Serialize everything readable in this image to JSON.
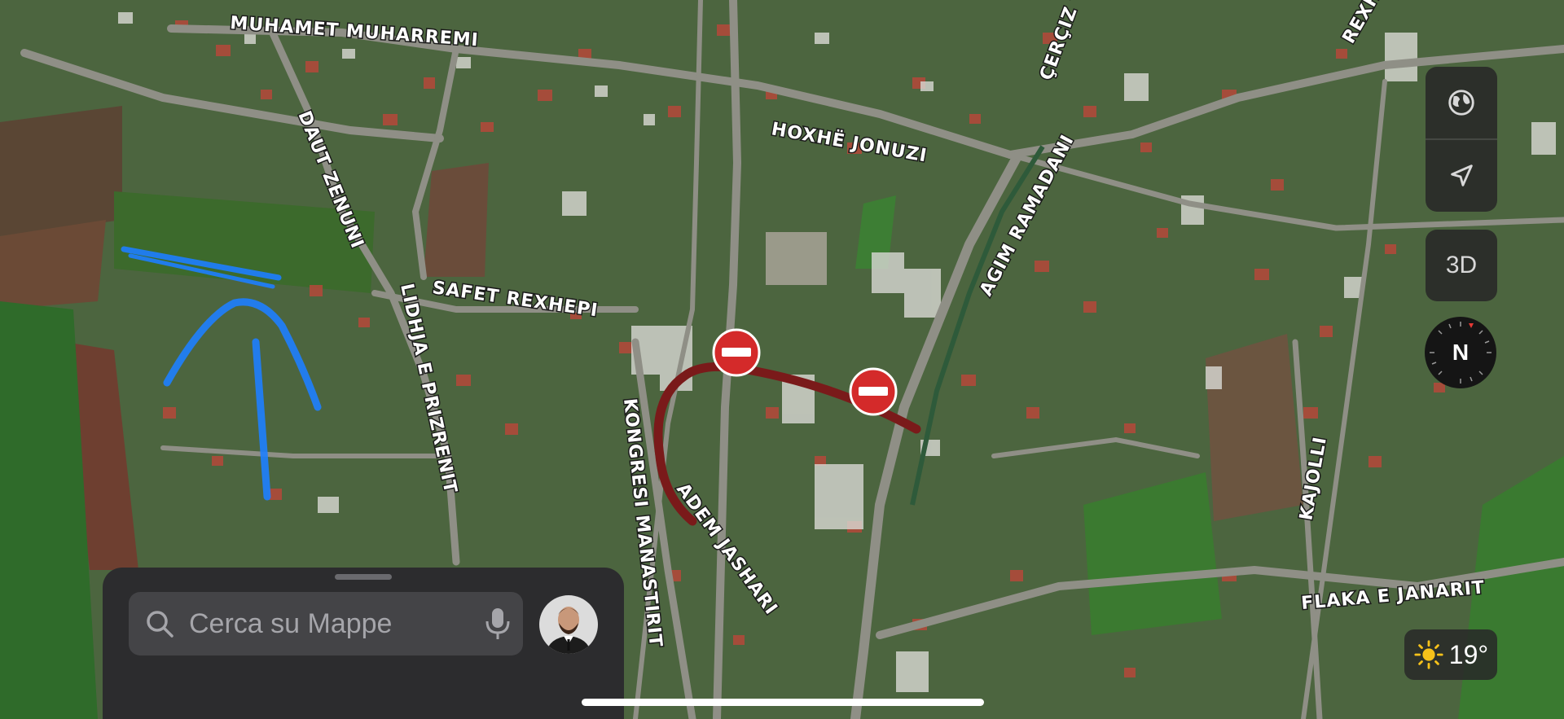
{
  "map": {
    "streets": [
      "MUHAMET MUHARREMI",
      "HOXHË JONUZI",
      "ÇERÇIZ TOPULLI",
      "REXHEP",
      "DAUT ZENUNI",
      "AGIM RAMADANI",
      "SAFET REXHEPI",
      "LIDHJA E PRIZRENIT",
      "KONGRESI MANASTIRIT",
      "ADEM JASHARI",
      "KAJOLLI",
      "FLAKA E JANARIT"
    ],
    "route_color": "#7a1a1a",
    "annotation_color": "#1e7fff",
    "restriction_color": "#d42a2a"
  },
  "controls": {
    "map_mode_icon": "globe-icon",
    "location_icon": "location-arrow-icon",
    "view_3d_label": "3D",
    "compass_label": "N"
  },
  "weather": {
    "icon": "sun-icon",
    "temperature": "19°"
  },
  "search": {
    "placeholder": "Cerca su Mappe",
    "icon": "search-icon",
    "voice_icon": "microphone-icon"
  }
}
